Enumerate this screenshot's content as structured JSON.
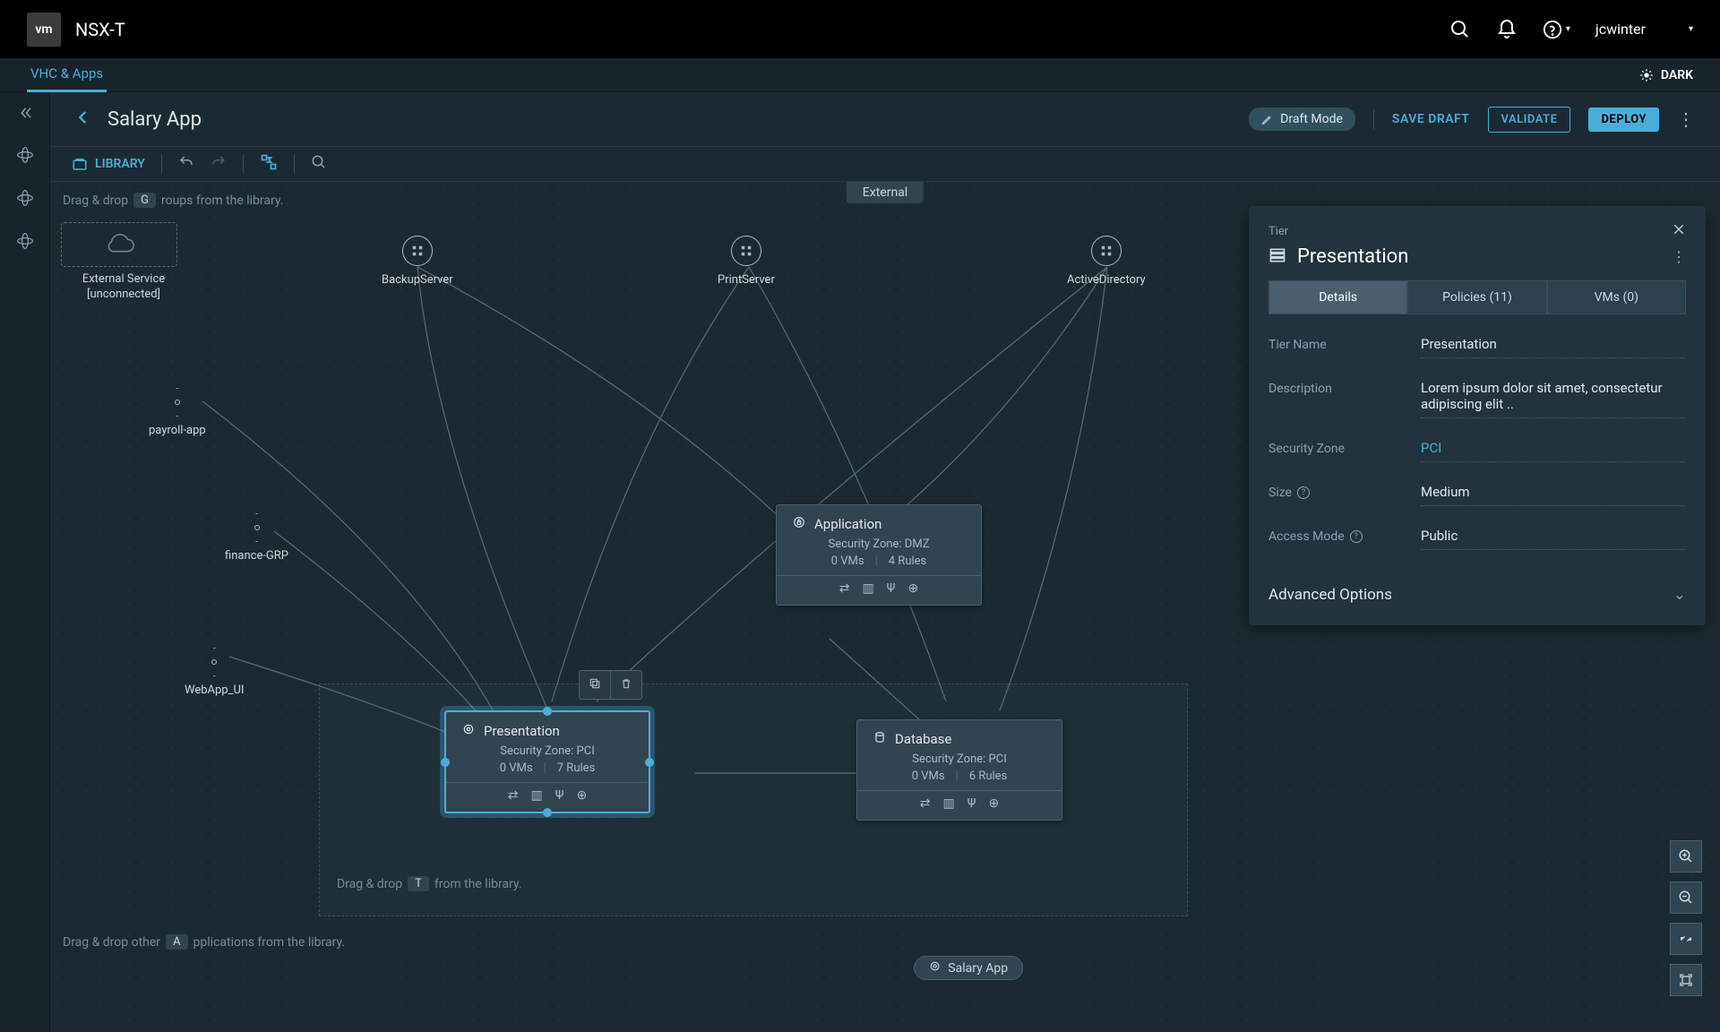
{
  "topbar": {
    "logo": "vm",
    "product": "NSX-T",
    "user": "jcwinter"
  },
  "tabrow": {
    "tab": "VHC & Apps",
    "theme": "DARK"
  },
  "page": {
    "title": "Salary App",
    "draft_mode": "Draft Mode",
    "save_draft": "SAVE DRAFT",
    "validate": "VALIDATE",
    "deploy": "DEPLOY"
  },
  "toolbar": {
    "library": "LIBRARY"
  },
  "canvas": {
    "hint_groups_pre": "Drag & drop",
    "hint_groups_key": "G",
    "hint_groups_post": "roups from the library.",
    "hint_tiers_pre": "Drag & drop",
    "hint_tiers_key": "T",
    "hint_tiers_post": "from the library.",
    "hint_apps_pre": "Drag & drop other",
    "hint_apps_key": "A",
    "hint_apps_post": "pplications from the library.",
    "external_tab": "External",
    "external_placeholder_l1": "External Service",
    "external_placeholder_l2": "[unconnected]",
    "bottom_pill": "Salary App",
    "round_nodes": {
      "backup": "BackupServer",
      "print": "PrintServer",
      "ad": "ActiveDirectory"
    },
    "hex_nodes": {
      "payroll": "payroll-app",
      "finance": "finance-GRP",
      "webapp": "WebApp_UI"
    },
    "tiers": {
      "application": {
        "name": "Application",
        "sz": "Security Zone: DMZ",
        "vms": "0 VMs",
        "rules": "4 Rules"
      },
      "presentation": {
        "name": "Presentation",
        "sz": "Security Zone: PCI",
        "vms": "0 VMs",
        "rules": "7 Rules"
      },
      "database": {
        "name": "Database",
        "sz": "Security Zone: PCI",
        "vms": "0 VMs",
        "rules": "6 Rules"
      }
    }
  },
  "panel": {
    "subtitle": "Tier",
    "title": "Presentation",
    "tabs": {
      "details": "Details",
      "policies": "Policies (11)",
      "vms": "VMs (0)"
    },
    "fields": {
      "tier_name_label": "Tier Name",
      "tier_name_value": "Presentation",
      "description_label": "Description",
      "description_value": "Lorem ipsum dolor sit amet, consectetur adipiscing elit ..",
      "security_zone_label": "Security Zone",
      "security_zone_value": "PCI",
      "size_label": "Size",
      "size_value": "Medium",
      "access_mode_label": "Access Mode",
      "access_mode_value": "Public"
    },
    "advanced": "Advanced Options"
  }
}
